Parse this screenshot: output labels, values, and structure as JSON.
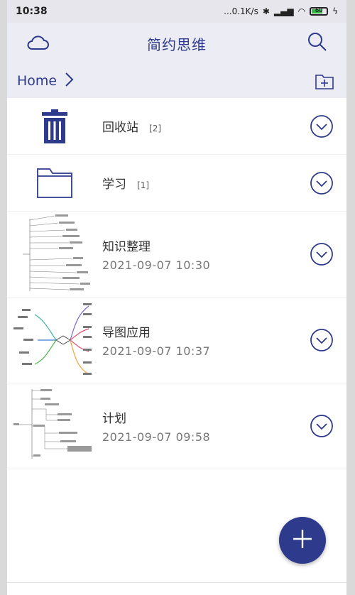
{
  "status_bar": {
    "time": "10:38",
    "network_speed": "...0.1K/s",
    "battery": "60"
  },
  "app_bar": {
    "title": "简约思维",
    "left_icon": "cloud-icon",
    "right_icon": "search-icon"
  },
  "path_bar": {
    "crumb": "Home",
    "new_folder_icon": "folder-plus-icon"
  },
  "items": [
    {
      "name": "回收站",
      "count": "[2]",
      "icon": "trash-icon"
    },
    {
      "name": "学习",
      "count": "[1]",
      "icon": "folder-icon"
    },
    {
      "name": "知识整理",
      "date": "2021-09-07 10:30",
      "icon": "mindmap-thumbnail"
    },
    {
      "name": "导图应用",
      "date": "2021-09-07 10:37",
      "icon": "mindmap-thumbnail"
    },
    {
      "name": "计划",
      "date": "2021-09-07 09:58",
      "icon": "mindmap-thumbnail"
    }
  ],
  "fab": {
    "icon": "plus-icon"
  },
  "colors": {
    "accent": "#2e3a8c",
    "header_bg": "#ececf4"
  }
}
